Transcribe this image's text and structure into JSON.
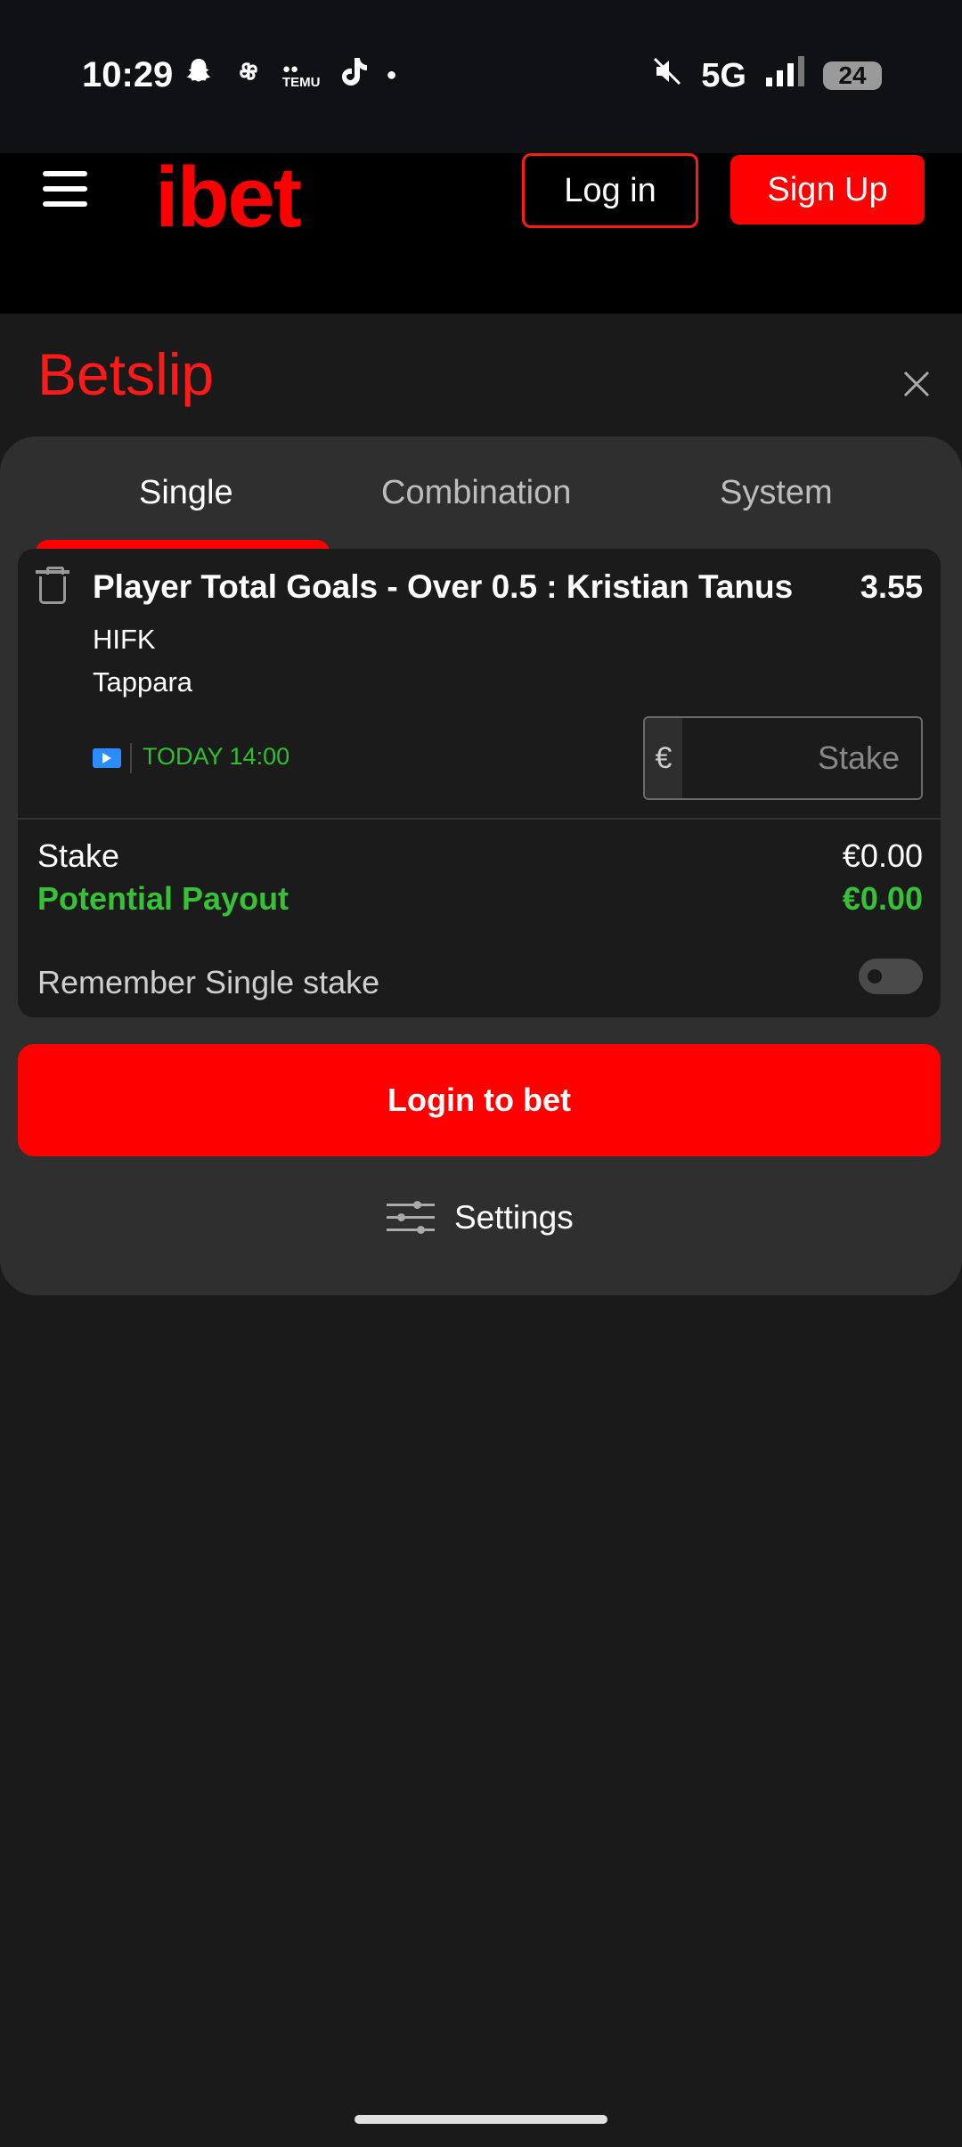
{
  "status_bar": {
    "time": "10:29",
    "network": "5G",
    "battery": "24",
    "left_icons": [
      "snapchat-icon",
      "pinwheel-icon",
      "temu-icon",
      "tiktok-icon",
      "dot-icon"
    ],
    "right_icons": [
      "mute-icon",
      "signal-icon",
      "battery-icon"
    ]
  },
  "header": {
    "logo": "ibet",
    "login_label": "Log in",
    "signup_label": "Sign Up",
    "accent_color": "#ff0000"
  },
  "betslip": {
    "title": "Betslip",
    "tabs": [
      {
        "label": "Single",
        "active": true
      },
      {
        "label": "Combination",
        "active": false
      },
      {
        "label": "System",
        "active": false
      }
    ],
    "selection": {
      "name": "Player Total Goals - Over 0.5 : Kristian Tanus",
      "odds": "3.55",
      "team1": "HIFK",
      "team2": "Tappara",
      "time": "TODAY 14:00",
      "currency": "€",
      "stake_placeholder": "Stake"
    },
    "summary": {
      "stake_label": "Stake",
      "stake_value": "€0.00",
      "payout_label": "Potential Payout",
      "payout_value": "€0.00"
    },
    "remember_label": "Remember Single stake",
    "remember_on": false,
    "login_to_bet": "Login to bet",
    "settings_label": "Settings"
  }
}
